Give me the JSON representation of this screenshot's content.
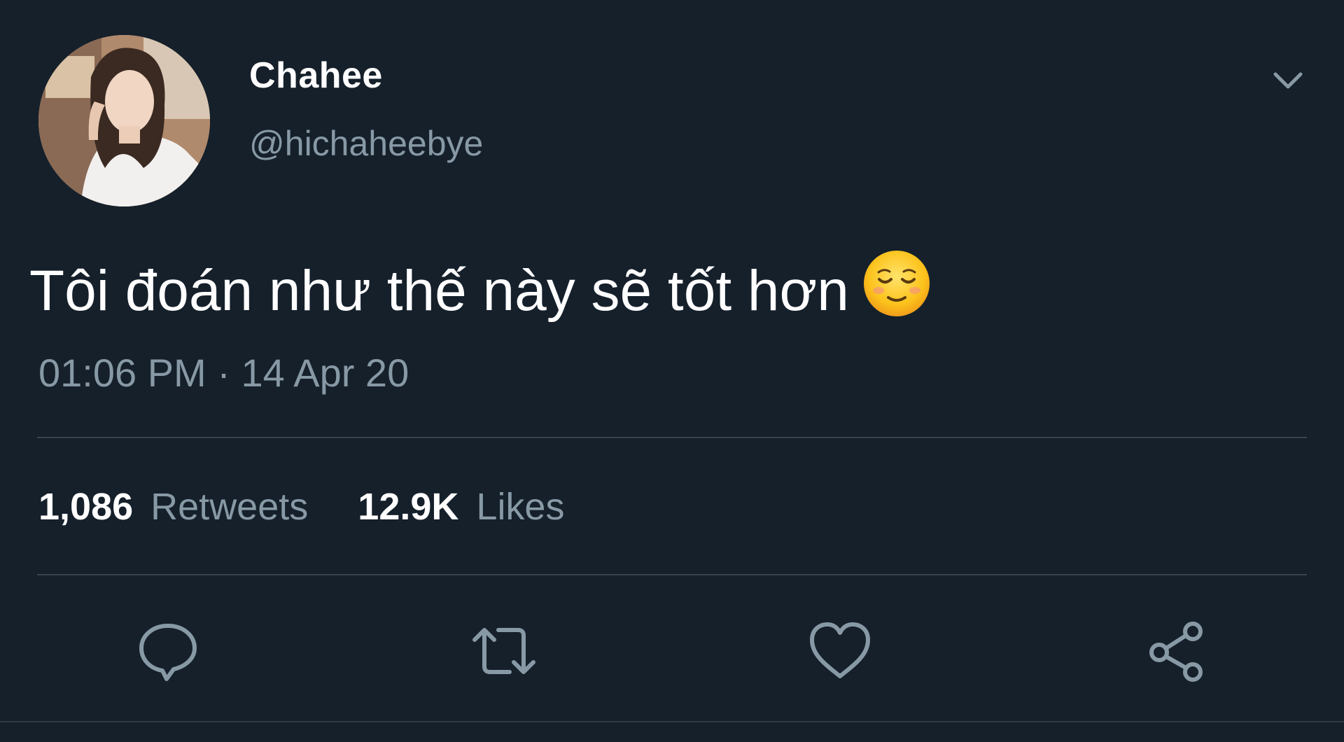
{
  "user": {
    "display_name": "Chahee",
    "handle": "@hichaheebye",
    "avatar": "profile-photo"
  },
  "tweet": {
    "text": "Tôi đoán như thế này sẽ tốt hơn",
    "emoji": "relieved-face-emoji",
    "timestamp": "01:06 PM · 14 Apr 20"
  },
  "stats": {
    "retweets_count": "1,086",
    "retweets_label": "Retweets",
    "likes_count": "12.9K",
    "likes_label": "Likes"
  },
  "actions": {
    "reply_icon": "reply-icon",
    "retweet_icon": "retweet-icon",
    "like_icon": "heart-icon",
    "share_icon": "share-icon",
    "menu_icon": "chevron-down-icon"
  },
  "colors": {
    "background": "#15202b",
    "primary_text": "#ffffff",
    "secondary_text": "#8899a6",
    "divider": "#38444d"
  }
}
